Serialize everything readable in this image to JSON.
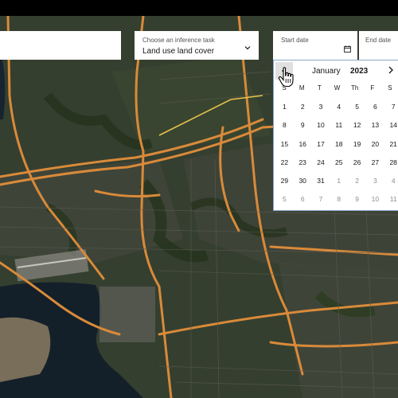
{
  "task_selector": {
    "label": "Choose an inference task",
    "value": "Land use land cover"
  },
  "start_date": {
    "label": "Start date"
  },
  "end_date": {
    "label": "End date"
  },
  "calendar": {
    "month": "January",
    "year": "2023",
    "weekdays": [
      "S",
      "M",
      "T",
      "W",
      "Th",
      "F",
      "S"
    ],
    "days": [
      {
        "n": "1",
        "muted": false
      },
      {
        "n": "2",
        "muted": false
      },
      {
        "n": "3",
        "muted": false
      },
      {
        "n": "4",
        "muted": false
      },
      {
        "n": "5",
        "muted": false
      },
      {
        "n": "6",
        "muted": false
      },
      {
        "n": "7",
        "muted": false
      },
      {
        "n": "8",
        "muted": false
      },
      {
        "n": "9",
        "muted": false
      },
      {
        "n": "10",
        "muted": false
      },
      {
        "n": "11",
        "muted": false
      },
      {
        "n": "12",
        "muted": false
      },
      {
        "n": "13",
        "muted": false
      },
      {
        "n": "14",
        "muted": false
      },
      {
        "n": "15",
        "muted": false
      },
      {
        "n": "16",
        "muted": false
      },
      {
        "n": "17",
        "muted": false
      },
      {
        "n": "18",
        "muted": false
      },
      {
        "n": "19",
        "muted": false
      },
      {
        "n": "20",
        "muted": false
      },
      {
        "n": "21",
        "muted": false
      },
      {
        "n": "22",
        "muted": false
      },
      {
        "n": "23",
        "muted": false
      },
      {
        "n": "24",
        "muted": false
      },
      {
        "n": "25",
        "muted": false
      },
      {
        "n": "26",
        "muted": false
      },
      {
        "n": "27",
        "muted": false
      },
      {
        "n": "28",
        "muted": false
      },
      {
        "n": "29",
        "muted": false
      },
      {
        "n": "30",
        "muted": false
      },
      {
        "n": "31",
        "muted": false
      },
      {
        "n": "1",
        "muted": true
      },
      {
        "n": "2",
        "muted": true
      },
      {
        "n": "3",
        "muted": true
      },
      {
        "n": "4",
        "muted": true
      },
      {
        "n": "5",
        "muted": true
      },
      {
        "n": "6",
        "muted": true
      },
      {
        "n": "7",
        "muted": true
      },
      {
        "n": "8",
        "muted": true
      },
      {
        "n": "9",
        "muted": true
      },
      {
        "n": "10",
        "muted": true
      },
      {
        "n": "11",
        "muted": true
      }
    ]
  },
  "icons": {
    "prev": "chevron-left-icon",
    "next": "chevron-right-icon",
    "dropdown": "chevron-down-icon",
    "calendar": "calendar-icon",
    "cursor": "hand-pointer-icon"
  },
  "colors": {
    "map_base": "#2b3325",
    "road": "#d98a3a",
    "water": "#14222c",
    "panel_bg": "#ffffff",
    "calendar_border": "#8aa6c8",
    "prev_button_bg": "#e0e0e0",
    "muted_text": "#8d8d8d"
  }
}
